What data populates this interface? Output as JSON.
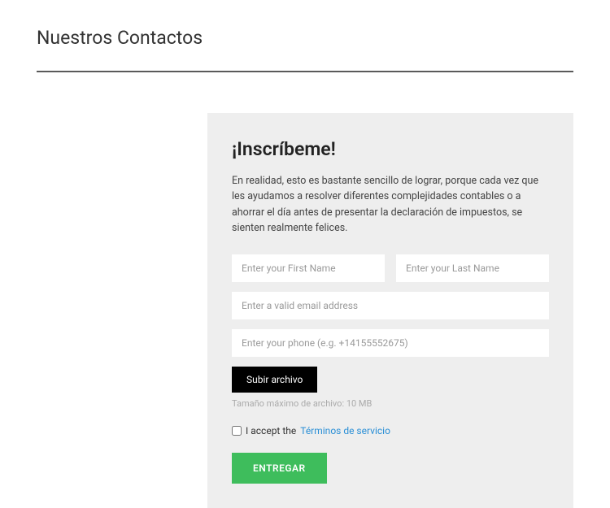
{
  "page": {
    "title": "Nuestros Contactos"
  },
  "form": {
    "title": "¡Inscríbeme!",
    "description": "En realidad, esto es bastante sencillo de lograr, porque cada vez que les ayudamos a resolver diferentes complejidades contables o a ahorrar el día antes de presentar la declaración de impuestos, se sienten realmente felices.",
    "first_name_placeholder": "Enter your First Name",
    "last_name_placeholder": "Enter your Last Name",
    "email_placeholder": "Enter a valid email address",
    "phone_placeholder": "Enter your phone (e.g. +14155552675)",
    "upload_label": "Subir archivo",
    "upload_hint": "Tamaño máximo de archivo: 10 MB",
    "accept_prefix": "I accept the ",
    "tos_label": "Términos de servicio",
    "submit_label": "ENTREGAR"
  }
}
